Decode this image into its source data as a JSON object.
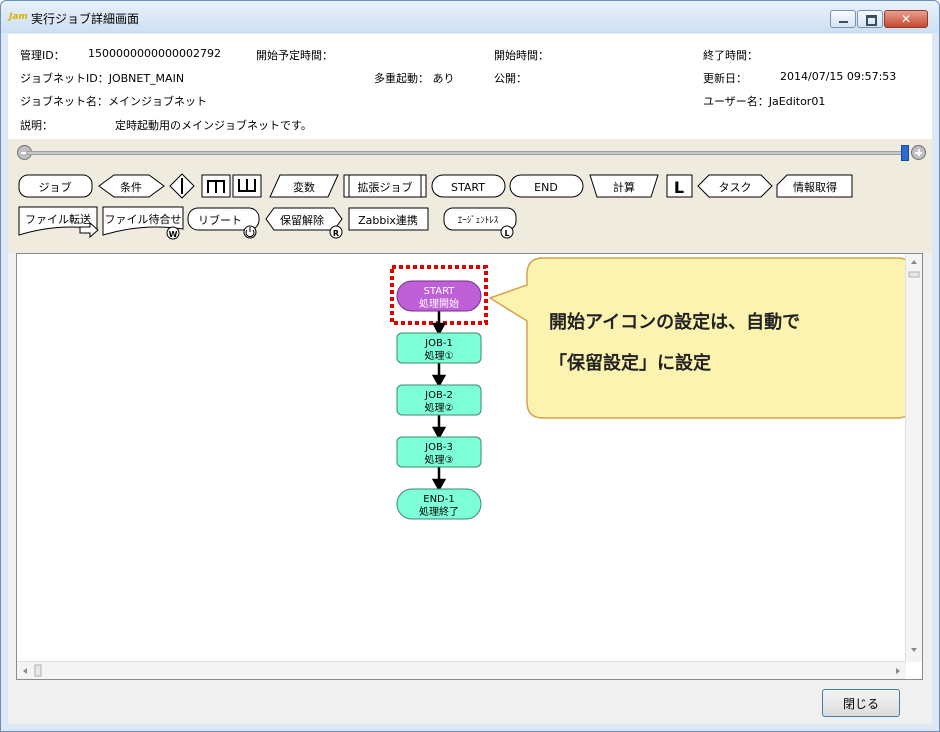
{
  "window": {
    "title": "実行ジョブ詳細画面",
    "app_icon_text": "Jam"
  },
  "info": {
    "manage_id_label": "管理ID：",
    "manage_id_value": "1500000000000002792",
    "start_sched_label": "開始予定時間：",
    "start_time_label": "開始時間：",
    "end_time_label": "終了時間：",
    "jobnet_id": "ジョブネットID：JOBNET_MAIN",
    "multi_start": "多重起動： あり",
    "public_label": "公開：",
    "updated_label": "更新日：",
    "updated_value": "2014/07/15 09:57:53",
    "jobnet_name": "ジョブネット名：メインジョブネット",
    "user_name": "ユーザー名：JaEditor01",
    "desc_label": "説明：",
    "desc_value": "定時起動用のメインジョブネットです。"
  },
  "palette": {
    "job": "ジョブ",
    "condition": "条件",
    "variable": "変数",
    "ext_job": "拡張ジョブ",
    "start": "START",
    "end": "END",
    "calc": "計算",
    "loop": "L",
    "task": "タスク",
    "info_get": "情報取得",
    "file_transfer": "ファイル転送",
    "file_wait": "ファイル待合せ",
    "reboot": "リブート",
    "hold_release": "保留解除",
    "zabbix": "Zabbix連携",
    "agentless": "ｴｰｼﾞｪﾝﾄﾚｽ"
  },
  "flow": [
    {
      "line1": "START",
      "line2": "処理開始"
    },
    {
      "line1": "JOB-1",
      "line2": "処理①"
    },
    {
      "line1": "JOB-2",
      "line2": "処理②"
    },
    {
      "line1": "JOB-3",
      "line2": "処理③"
    },
    {
      "line1": "END-1",
      "line2": "処理終了"
    }
  ],
  "callout": {
    "line1": "開始アイコンの設定は、自動で",
    "line2": "「保留設定」に設定"
  },
  "close_button": "閉じる",
  "colors": {
    "start_node": "#c060d8",
    "job_node": "#7dffd8",
    "callout_fill": "#fdf3b0",
    "highlight": "#e00000"
  }
}
